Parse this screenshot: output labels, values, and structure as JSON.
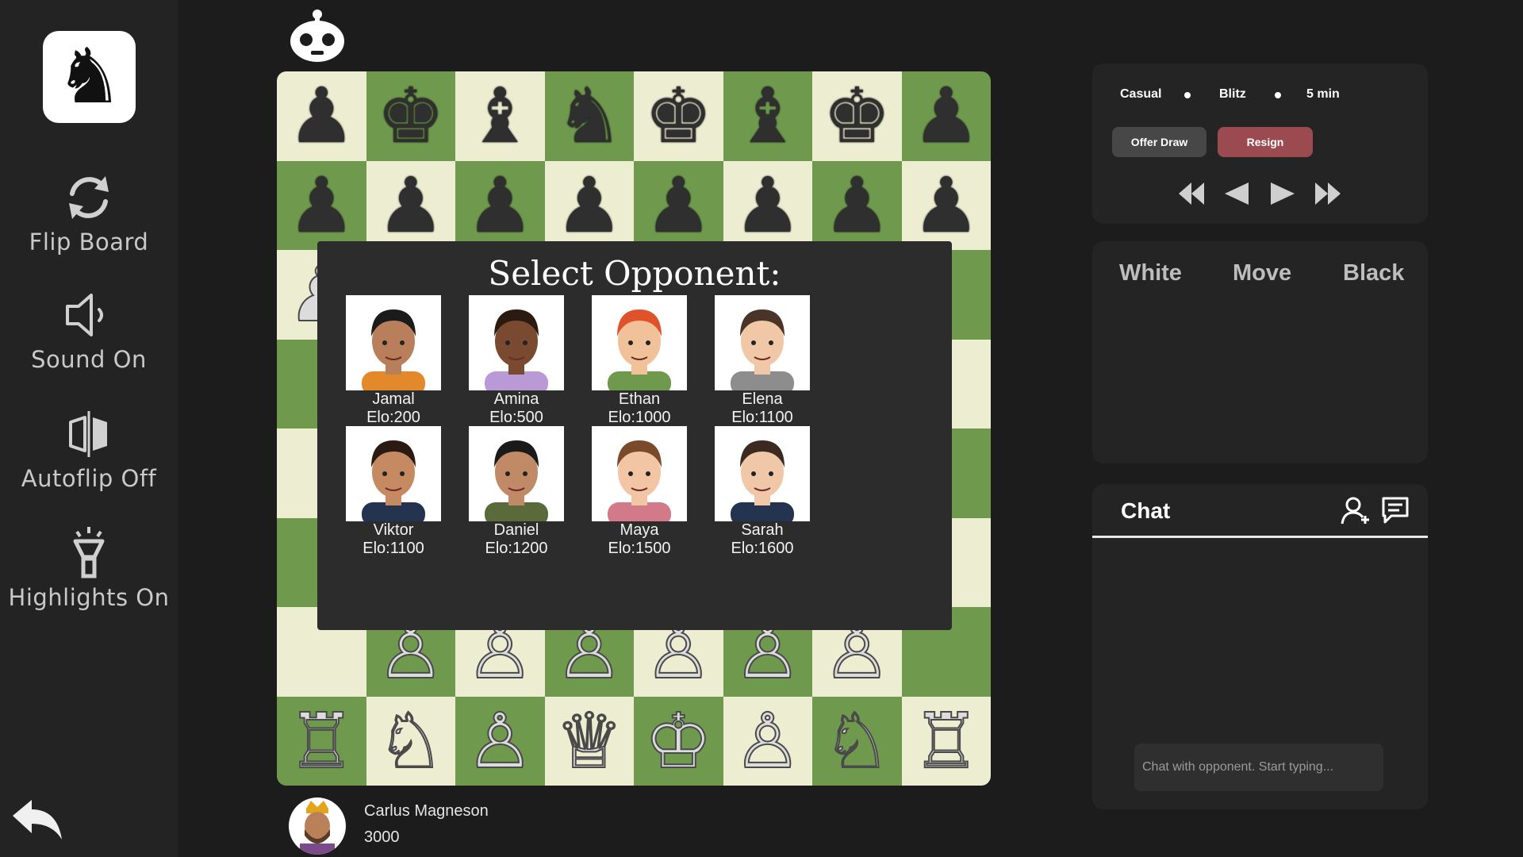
{
  "sidebar": {
    "items": [
      {
        "label": "Flip Board",
        "icon": "flip-icon"
      },
      {
        "label": "Sound On",
        "icon": "speaker-icon"
      },
      {
        "label": "Autoflip Off",
        "icon": "autoflip-icon"
      },
      {
        "label": "Highlights On",
        "icon": "flashlight-icon"
      }
    ]
  },
  "board": {
    "colors": {
      "light": "#ededd2",
      "dark": "#6f9a4d"
    },
    "rank8": [
      "♟",
      "♚",
      "♝",
      "♞",
      "♚",
      "♝",
      "♚",
      "♟"
    ],
    "rank1": [
      "♖",
      "♘",
      "♙",
      "♕",
      "♔",
      "♙",
      "♘",
      "♖"
    ]
  },
  "modal": {
    "title": "Select Opponent:",
    "opponents": [
      {
        "name": "Jamal",
        "elo": "Elo:200"
      },
      {
        "name": "Amina",
        "elo": "Elo:500"
      },
      {
        "name": "Ethan",
        "elo": "Elo:1000"
      },
      {
        "name": "Elena",
        "elo": "Elo:1100"
      },
      {
        "name": "Viktor",
        "elo": "Elo:1100"
      },
      {
        "name": "Daniel",
        "elo": "Elo:1200"
      },
      {
        "name": "Maya",
        "elo": "Elo:1500"
      },
      {
        "name": "Sarah",
        "elo": "Elo:1600"
      }
    ]
  },
  "game_info": {
    "mode": "Casual",
    "speed": "Blitz",
    "time": "5 min",
    "offer_draw": "Offer Draw",
    "resign": "Resign",
    "resign_color": "#9b4a4f"
  },
  "moves": {
    "white": "White",
    "move": "Move",
    "black": "Black"
  },
  "chat": {
    "title": "Chat",
    "placeholder": "Chat with opponent. Start typing..."
  },
  "player": {
    "name": "Carlus Magneson",
    "rating": "3000"
  }
}
